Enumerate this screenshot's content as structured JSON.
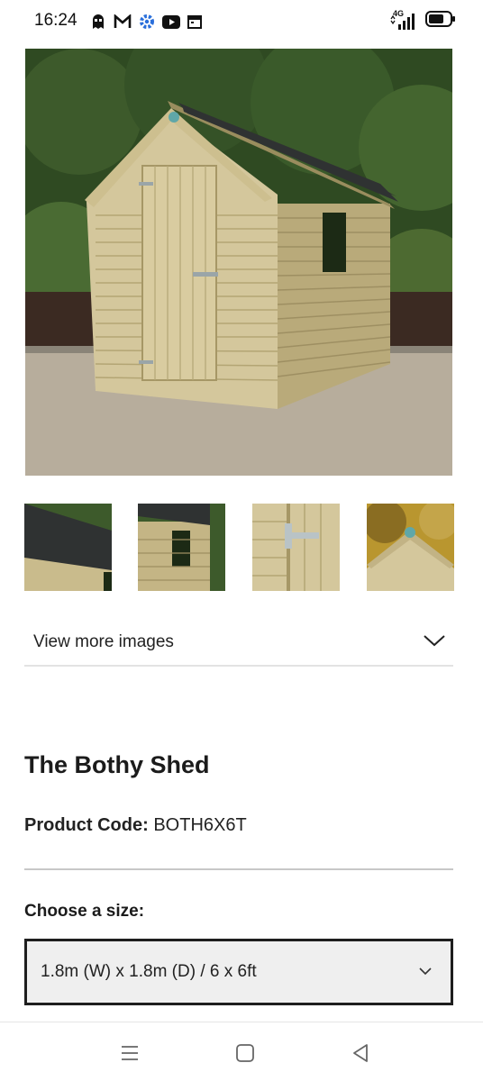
{
  "status_bar": {
    "time": "16:24",
    "network": "4G",
    "icons": [
      "ghost-app-icon",
      "gmail-icon",
      "settings-gear-icon",
      "youtube-icon",
      "calendar-icon"
    ]
  },
  "gallery": {
    "main_image": "wooden-shed-photo",
    "thumbnails": [
      "shed-roof-thumbnail",
      "shed-window-thumbnail",
      "shed-hinge-thumbnail",
      "shed-gable-thumbnail"
    ],
    "view_more_label": "View more images"
  },
  "product": {
    "title": "The Bothy Shed",
    "code_label": "Product Code:",
    "code_value": "BOTH6X6T"
  },
  "size_selector": {
    "label": "Choose a size:",
    "selected": "1.8m (W) x 1.8m (D) / 6 x 6ft"
  },
  "nav_bar": {
    "buttons": [
      "recents-menu-icon",
      "home-icon",
      "back-icon"
    ]
  },
  "colors": {
    "hedge": "#2f4a22",
    "wood": "#c9bb8c",
    "roof": "#2f3232",
    "gravel": "#b7ad9c",
    "select_border": "#1e1e1e",
    "select_bg": "#efefef"
  }
}
